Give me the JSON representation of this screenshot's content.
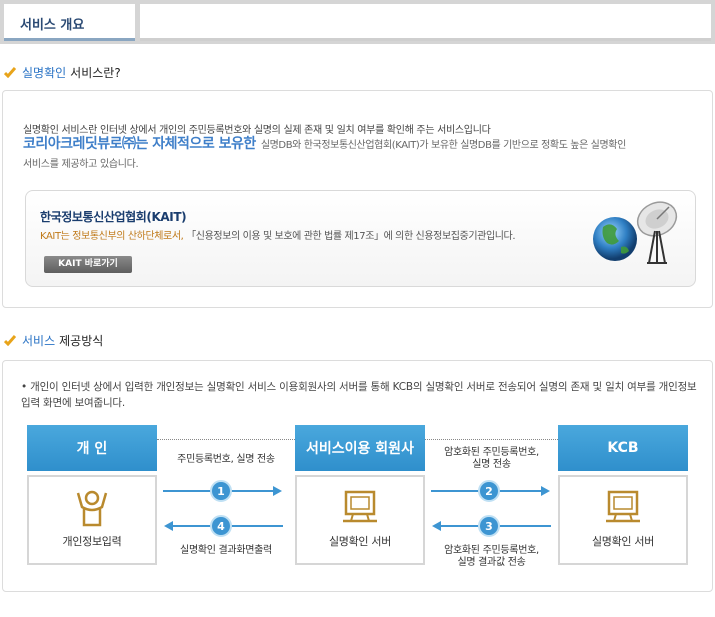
{
  "tabs": {
    "active_label": "서비스 개요"
  },
  "section1": {
    "title_blue": "실명확인",
    "title_dark": "서비스란?"
  },
  "intro": {
    "line1": "실명확인 서비스란 인터넷 상에서 개인의 주민등록번호와 실명의 실제 존재 및 일치 여부를 확인해 주는 서비스입니다",
    "line2_big": "코리아크레딧뷰로㈜는 자체적으로 보유한",
    "line2_small": "실명DB와  한국정보통신산업협회(KAIT)가 보유한 실명DB를 기반으로 정확도 높은 실명확인",
    "line3": "서비스를 제공하고 있습니다."
  },
  "kait": {
    "title": "한국정보통신산업협회(KAIT)",
    "desc_org": "KAIT는 정보통신부의 산하단체로서,",
    "desc_rest": " 「신용정보의 이용 및 보호에 관한 법률 제17조」에 의한 신용정보집중기관입니다.",
    "button_label": "KAIT 바로가기"
  },
  "section2": {
    "title_blue": "서비스",
    "title_dark": "제공방식"
  },
  "service": {
    "description": "개인이 인터넷 상에서 입력한 개인정보는 실명확인 서비스 이용회원사의 서버를 통해 KCB의 실명확인 서버로 전송되어 실명의 존재 및 일치 여부를 개인정보입력 화면에 보여줍니다.",
    "bullet": "•"
  },
  "diagram": {
    "nodes": [
      {
        "title": "개  인",
        "label": "개인정보입력",
        "icon": "person-icon"
      },
      {
        "title": "서비스이용 회원사",
        "label": "실명확인 서버",
        "icon": "computer-icon"
      },
      {
        "title": "KCB",
        "label": "실명확인 서버",
        "icon": "computer-icon"
      }
    ],
    "flows": [
      {
        "num": "1",
        "label": "주민등록번호, 실명 전송"
      },
      {
        "num": "2",
        "label1": "암호화된 주민등록번호,",
        "label2": "실명 전송"
      },
      {
        "num": "3",
        "label1": "암호화된 주민등록번호,",
        "label2": "실명 결과값  전송"
      },
      {
        "num": "4",
        "label": "실명확인 결과화면출력"
      }
    ]
  },
  "colors": {
    "accent": "#3d95d2",
    "heading_blue": "#2a73c5",
    "kait_orange": "#c07a1a"
  }
}
